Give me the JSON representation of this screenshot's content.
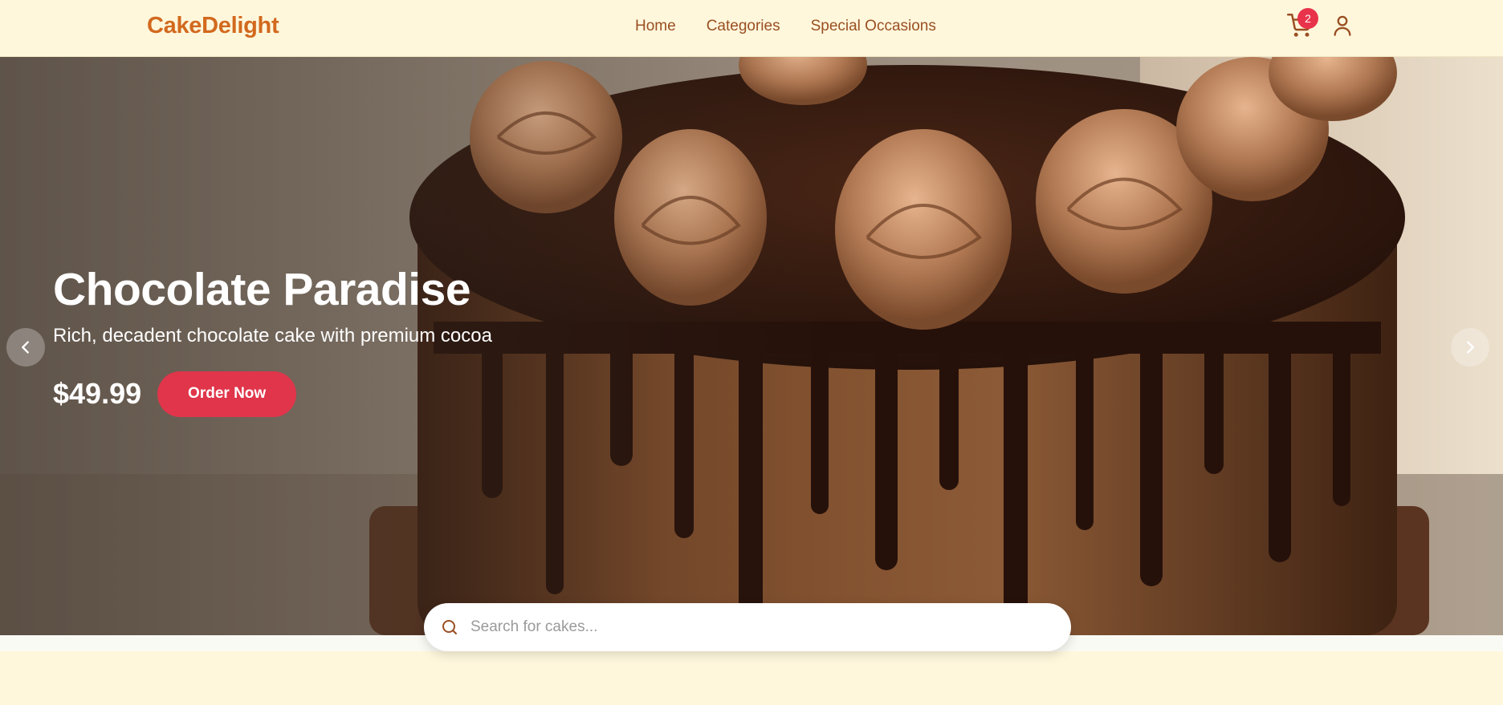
{
  "header": {
    "logo": "CakeDelight",
    "nav": [
      "Home",
      "Categories",
      "Special Occasions"
    ],
    "cart_count": "2",
    "icons": {
      "cart": "cart-icon",
      "user": "user-icon"
    }
  },
  "hero": {
    "title": "Chocolate Paradise",
    "subtitle": "Rich, decadent chocolate cake with premium cocoa",
    "price": "$49.99",
    "cta": "Order Now",
    "image": "chocolate drip cake with piped frosting swirls"
  },
  "search": {
    "placeholder": "Search for cakes..."
  },
  "colors": {
    "brand": "#d2691e",
    "accent": "#e0354a",
    "nav_text": "#9a4f22",
    "header_bg": "#fef7dc"
  }
}
